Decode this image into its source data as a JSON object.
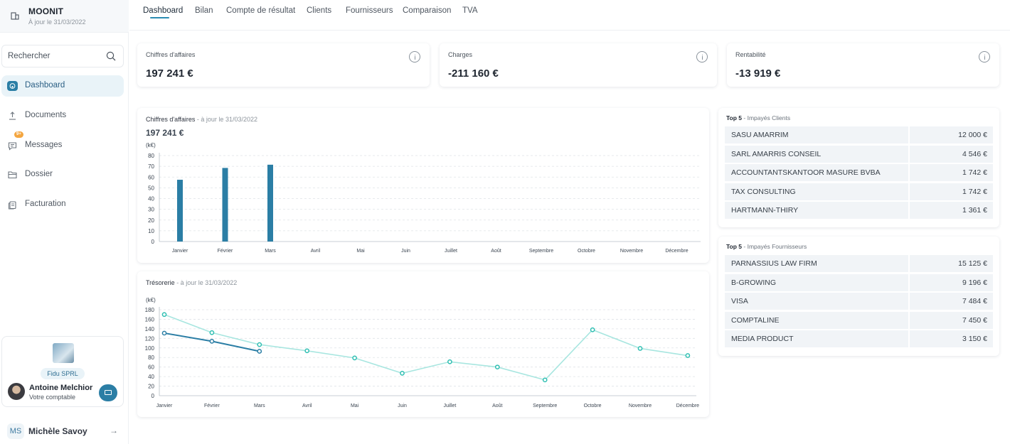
{
  "brand": {
    "name": "MOONIT",
    "subtitle": "À jour le 31/03/2022"
  },
  "search": {
    "placeholder": "Rechercher"
  },
  "nav": [
    {
      "label": "Dashboard",
      "icon": "home-icon",
      "active": true
    },
    {
      "label": "Documents",
      "icon": "upload-icon"
    },
    {
      "label": "Messages",
      "icon": "message-icon",
      "badge": "9+"
    },
    {
      "label": "Dossier",
      "icon": "folder-icon"
    },
    {
      "label": "Facturation",
      "icon": "invoice-icon"
    }
  ],
  "accountant": {
    "firm": "Fidu SPRL",
    "name": "Antoine Melchior",
    "role": "Votre comptable"
  },
  "user": {
    "initials": "MS",
    "name": "Michèle Savoy",
    "arrow": "→"
  },
  "tabs": [
    "Dashboard",
    "Bilan",
    "Compte de résultat",
    "Clients",
    "Fournisseurs",
    "Comparaison",
    "TVA"
  ],
  "kpis": [
    {
      "label": "Chiffres d'affaires",
      "value": "197 241 €"
    },
    {
      "label": "Charges",
      "value": "-211 160 €"
    },
    {
      "label": "Rentabilité",
      "value": "-13 919 €"
    }
  ],
  "revenue_chart": {
    "title": "Chiffres d'affaires",
    "subtitle": " - à jour le 31/03/2022",
    "total": "197 241 €"
  },
  "treasury_chart": {
    "title": "Trésorerie",
    "subtitle": " - à jour le 31/03/2022"
  },
  "top5_clients": {
    "bold": "Top 5",
    "label": " - Impayés Clients",
    "rows": [
      {
        "name": "SASU AMARRIM",
        "amount": "12 000 €"
      },
      {
        "name": "SARL AMARRIS CONSEIL",
        "amount": "4 546 €"
      },
      {
        "name": "ACCOUNTANTSKANTOOR MASURE BVBA",
        "amount": "1 742 €"
      },
      {
        "name": "TAX CONSULTING",
        "amount": "1 742 €"
      },
      {
        "name": "HARTMANN-THIRY",
        "amount": "1 361 €"
      }
    ]
  },
  "top5_suppliers": {
    "bold": "Top 5",
    "label": " - Impayés Fournisseurs",
    "rows": [
      {
        "name": "PARNASSIUS LAW FIRM",
        "amount": "15 125 €"
      },
      {
        "name": "B-GROWING",
        "amount": "9 196 €"
      },
      {
        "name": "VISA",
        "amount": "7 484 €"
      },
      {
        "name": "COMPTALINE",
        "amount": "7 450 €"
      },
      {
        "name": "MEDIA PRODUCT",
        "amount": "3 150 €"
      }
    ]
  },
  "colors": {
    "accent": "#2b8cb3",
    "bar": "#2b7ea5",
    "line_dark": "#2b7ea5",
    "line_light": "#a8e6e0",
    "point_light": "#2fbfb2"
  },
  "chart_data": [
    {
      "type": "bar",
      "ylabel": "(k€)",
      "categories": [
        "Janvier",
        "Février",
        "Mars",
        "Avril",
        "Mai",
        "Juin",
        "Juillet",
        "Août",
        "Septembre",
        "Octobre",
        "Novembre",
        "Décembre"
      ],
      "values": [
        57.5,
        68.5,
        71.5,
        null,
        null,
        null,
        null,
        null,
        null,
        null,
        null,
        null
      ],
      "ylim": [
        0,
        80
      ],
      "yticks": [
        0,
        10,
        20,
        30,
        40,
        50,
        60,
        70,
        80
      ],
      "grid": true
    },
    {
      "type": "line",
      "ylabel": "(k€)",
      "categories": [
        "Janvier",
        "Février",
        "Mars",
        "Avril",
        "Mai",
        "Juin",
        "Juillet",
        "Août",
        "Septembre",
        "Octobre",
        "Novembre",
        "Décembre"
      ],
      "series": [
        {
          "values": [
            170,
            132,
            107,
            94,
            79,
            47,
            71,
            60,
            33,
            138,
            99,
            84
          ]
        },
        {
          "values": [
            131,
            114,
            93,
            null,
            null,
            null,
            null,
            null,
            null,
            null,
            null,
            null
          ]
        }
      ],
      "ylim": [
        0,
        180
      ],
      "yticks": [
        0,
        20,
        40,
        60,
        80,
        100,
        120,
        140,
        160,
        180
      ],
      "grid": true
    }
  ]
}
